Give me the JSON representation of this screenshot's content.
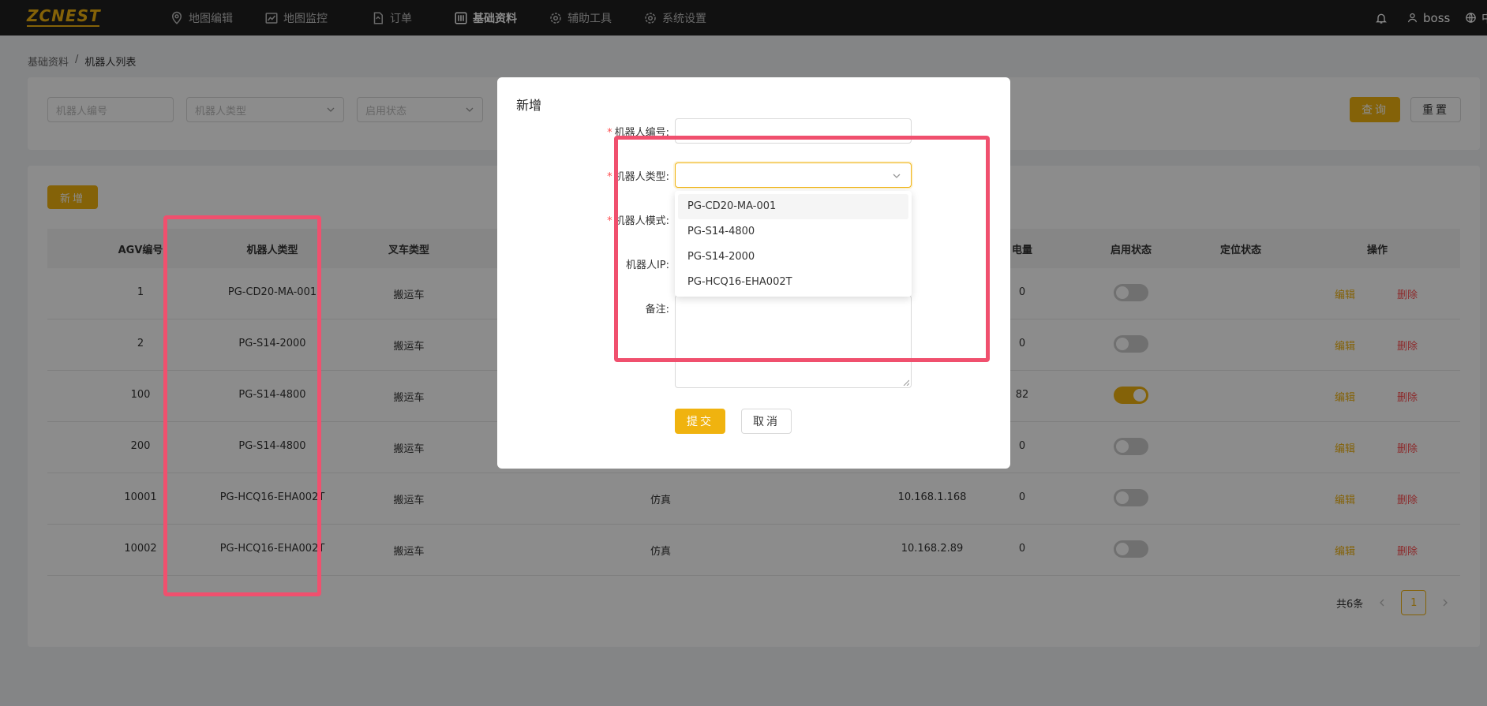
{
  "app": {
    "logo": "ZCNEST",
    "nav": [
      {
        "label": "地图编辑",
        "icon": "map-pin-icon"
      },
      {
        "label": "地图监控",
        "icon": "chart-icon"
      },
      {
        "label": "订单",
        "icon": "document-icon"
      },
      {
        "label": "基础资料",
        "icon": "sliders-icon",
        "active": true
      },
      {
        "label": "辅助工具",
        "icon": "gear-icon"
      },
      {
        "label": "系统设置",
        "icon": "gear-icon"
      }
    ],
    "user": "boss",
    "lang": "中"
  },
  "breadcrumb": {
    "parent": "基础资料",
    "sep": "/",
    "current": "机器人列表"
  },
  "search": {
    "robot_no_placeholder": "机器人编号",
    "robot_type_placeholder": "机器人类型",
    "enable_status_placeholder": "启用状态",
    "query_label": "查询",
    "reset_label": "重置"
  },
  "table": {
    "add_label": "新增",
    "columns": [
      "AGV编号",
      "机器人类型",
      "叉车类型",
      "电量",
      "启用状态",
      "定位状态",
      "操作"
    ],
    "rows": [
      {
        "agv": "1",
        "type": "PG-CD20-MA-001",
        "fork": "搬运车",
        "mode": "",
        "ip": "",
        "battery": "0",
        "enabled": false
      },
      {
        "agv": "2",
        "type": "PG-S14-2000",
        "fork": "搬运车",
        "mode": "",
        "ip": "",
        "battery": "0",
        "enabled": false
      },
      {
        "agv": "100",
        "type": "PG-S14-4800",
        "fork": "搬运车",
        "mode": "",
        "ip": "",
        "battery": "82",
        "enabled": true
      },
      {
        "agv": "200",
        "type": "PG-S14-4800",
        "fork": "搬运车",
        "mode": "",
        "ip": "",
        "battery": "0",
        "enabled": false
      },
      {
        "agv": "10001",
        "type": "PG-HCQ16-EHA002T",
        "fork": "搬运车",
        "mode": "仿真",
        "ip": "10.168.1.168",
        "battery": "0",
        "enabled": false
      },
      {
        "agv": "10002",
        "type": "PG-HCQ16-EHA002T",
        "fork": "搬运车",
        "mode": "仿真",
        "ip": "10.168.2.89",
        "battery": "0",
        "enabled": false
      }
    ],
    "edit_label": "编辑",
    "delete_label": "删除",
    "total": "共6条",
    "page": "1"
  },
  "modal": {
    "title": "新增",
    "fields": {
      "robot_no": "机器人编号:",
      "robot_type": "机器人类型:",
      "robot_mode": "机器人模式:",
      "robot_ip": "机器人IP:",
      "remark": "备注:"
    },
    "options": [
      "PG-CD20-MA-001",
      "PG-S14-4800",
      "PG-S14-2000",
      "PG-HCQ16-EHA002T"
    ],
    "submit_label": "提交",
    "cancel_label": "取消"
  },
  "colors": {
    "accent": "#f0b30f",
    "danger": "#ff4d4f",
    "highlight": "#f0506e"
  }
}
